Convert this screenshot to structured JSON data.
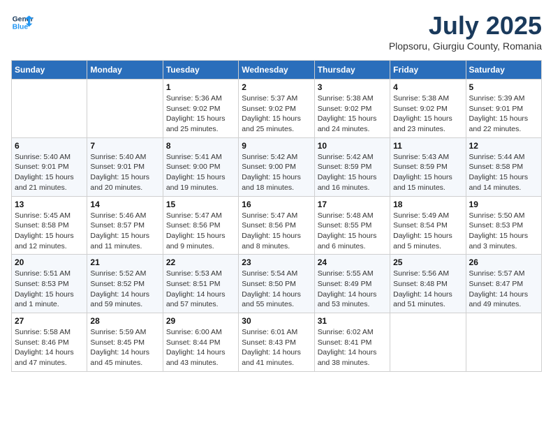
{
  "logo": {
    "line1": "General",
    "line2": "Blue"
  },
  "title": "July 2025",
  "location": "Plopsoru, Giurgiu County, Romania",
  "weekdays": [
    "Sunday",
    "Monday",
    "Tuesday",
    "Wednesday",
    "Thursday",
    "Friday",
    "Saturday"
  ],
  "weeks": [
    [
      null,
      null,
      {
        "day": 1,
        "sunrise": "Sunrise: 5:36 AM",
        "sunset": "Sunset: 9:02 PM",
        "daylight": "Daylight: 15 hours and 25 minutes."
      },
      {
        "day": 2,
        "sunrise": "Sunrise: 5:37 AM",
        "sunset": "Sunset: 9:02 PM",
        "daylight": "Daylight: 15 hours and 25 minutes."
      },
      {
        "day": 3,
        "sunrise": "Sunrise: 5:38 AM",
        "sunset": "Sunset: 9:02 PM",
        "daylight": "Daylight: 15 hours and 24 minutes."
      },
      {
        "day": 4,
        "sunrise": "Sunrise: 5:38 AM",
        "sunset": "Sunset: 9:02 PM",
        "daylight": "Daylight: 15 hours and 23 minutes."
      },
      {
        "day": 5,
        "sunrise": "Sunrise: 5:39 AM",
        "sunset": "Sunset: 9:01 PM",
        "daylight": "Daylight: 15 hours and 22 minutes."
      }
    ],
    [
      {
        "day": 6,
        "sunrise": "Sunrise: 5:40 AM",
        "sunset": "Sunset: 9:01 PM",
        "daylight": "Daylight: 15 hours and 21 minutes."
      },
      {
        "day": 7,
        "sunrise": "Sunrise: 5:40 AM",
        "sunset": "Sunset: 9:01 PM",
        "daylight": "Daylight: 15 hours and 20 minutes."
      },
      {
        "day": 8,
        "sunrise": "Sunrise: 5:41 AM",
        "sunset": "Sunset: 9:00 PM",
        "daylight": "Daylight: 15 hours and 19 minutes."
      },
      {
        "day": 9,
        "sunrise": "Sunrise: 5:42 AM",
        "sunset": "Sunset: 9:00 PM",
        "daylight": "Daylight: 15 hours and 18 minutes."
      },
      {
        "day": 10,
        "sunrise": "Sunrise: 5:42 AM",
        "sunset": "Sunset: 8:59 PM",
        "daylight": "Daylight: 15 hours and 16 minutes."
      },
      {
        "day": 11,
        "sunrise": "Sunrise: 5:43 AM",
        "sunset": "Sunset: 8:59 PM",
        "daylight": "Daylight: 15 hours and 15 minutes."
      },
      {
        "day": 12,
        "sunrise": "Sunrise: 5:44 AM",
        "sunset": "Sunset: 8:58 PM",
        "daylight": "Daylight: 15 hours and 14 minutes."
      }
    ],
    [
      {
        "day": 13,
        "sunrise": "Sunrise: 5:45 AM",
        "sunset": "Sunset: 8:58 PM",
        "daylight": "Daylight: 15 hours and 12 minutes."
      },
      {
        "day": 14,
        "sunrise": "Sunrise: 5:46 AM",
        "sunset": "Sunset: 8:57 PM",
        "daylight": "Daylight: 15 hours and 11 minutes."
      },
      {
        "day": 15,
        "sunrise": "Sunrise: 5:47 AM",
        "sunset": "Sunset: 8:56 PM",
        "daylight": "Daylight: 15 hours and 9 minutes."
      },
      {
        "day": 16,
        "sunrise": "Sunrise: 5:47 AM",
        "sunset": "Sunset: 8:56 PM",
        "daylight": "Daylight: 15 hours and 8 minutes."
      },
      {
        "day": 17,
        "sunrise": "Sunrise: 5:48 AM",
        "sunset": "Sunset: 8:55 PM",
        "daylight": "Daylight: 15 hours and 6 minutes."
      },
      {
        "day": 18,
        "sunrise": "Sunrise: 5:49 AM",
        "sunset": "Sunset: 8:54 PM",
        "daylight": "Daylight: 15 hours and 5 minutes."
      },
      {
        "day": 19,
        "sunrise": "Sunrise: 5:50 AM",
        "sunset": "Sunset: 8:53 PM",
        "daylight": "Daylight: 15 hours and 3 minutes."
      }
    ],
    [
      {
        "day": 20,
        "sunrise": "Sunrise: 5:51 AM",
        "sunset": "Sunset: 8:53 PM",
        "daylight": "Daylight: 15 hours and 1 minute."
      },
      {
        "day": 21,
        "sunrise": "Sunrise: 5:52 AM",
        "sunset": "Sunset: 8:52 PM",
        "daylight": "Daylight: 14 hours and 59 minutes."
      },
      {
        "day": 22,
        "sunrise": "Sunrise: 5:53 AM",
        "sunset": "Sunset: 8:51 PM",
        "daylight": "Daylight: 14 hours and 57 minutes."
      },
      {
        "day": 23,
        "sunrise": "Sunrise: 5:54 AM",
        "sunset": "Sunset: 8:50 PM",
        "daylight": "Daylight: 14 hours and 55 minutes."
      },
      {
        "day": 24,
        "sunrise": "Sunrise: 5:55 AM",
        "sunset": "Sunset: 8:49 PM",
        "daylight": "Daylight: 14 hours and 53 minutes."
      },
      {
        "day": 25,
        "sunrise": "Sunrise: 5:56 AM",
        "sunset": "Sunset: 8:48 PM",
        "daylight": "Daylight: 14 hours and 51 minutes."
      },
      {
        "day": 26,
        "sunrise": "Sunrise: 5:57 AM",
        "sunset": "Sunset: 8:47 PM",
        "daylight": "Daylight: 14 hours and 49 minutes."
      }
    ],
    [
      {
        "day": 27,
        "sunrise": "Sunrise: 5:58 AM",
        "sunset": "Sunset: 8:46 PM",
        "daylight": "Daylight: 14 hours and 47 minutes."
      },
      {
        "day": 28,
        "sunrise": "Sunrise: 5:59 AM",
        "sunset": "Sunset: 8:45 PM",
        "daylight": "Daylight: 14 hours and 45 minutes."
      },
      {
        "day": 29,
        "sunrise": "Sunrise: 6:00 AM",
        "sunset": "Sunset: 8:44 PM",
        "daylight": "Daylight: 14 hours and 43 minutes."
      },
      {
        "day": 30,
        "sunrise": "Sunrise: 6:01 AM",
        "sunset": "Sunset: 8:43 PM",
        "daylight": "Daylight: 14 hours and 41 minutes."
      },
      {
        "day": 31,
        "sunrise": "Sunrise: 6:02 AM",
        "sunset": "Sunset: 8:41 PM",
        "daylight": "Daylight: 14 hours and 38 minutes."
      },
      null,
      null
    ]
  ]
}
